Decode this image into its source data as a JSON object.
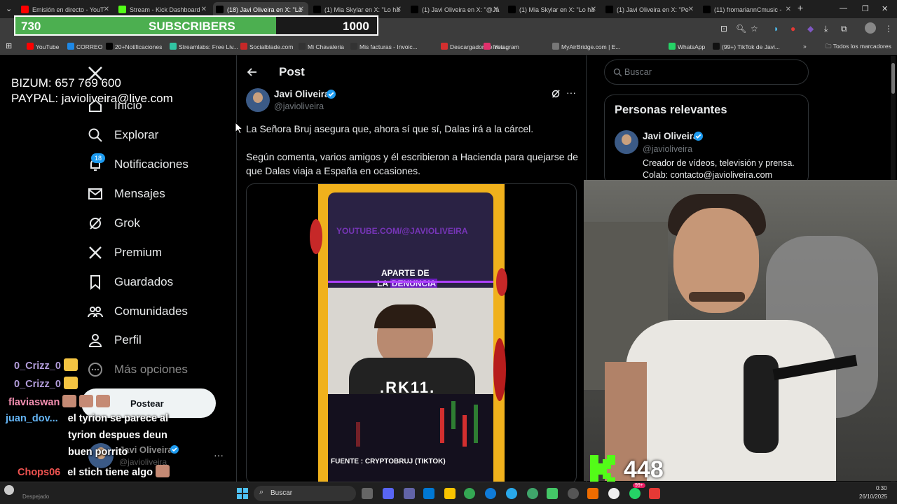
{
  "browser": {
    "tabs": [
      {
        "label": "Emisión en directo - YouT",
        "color": "#ff0000"
      },
      {
        "label": "Stream - Kick Dashboard",
        "color": "#53fc18"
      },
      {
        "label": "(18) Javi Oliveira en X: \"La",
        "color": "#000000"
      },
      {
        "label": "(1) Mia Skylar en X: \"Lo ha",
        "color": "#000000"
      },
      {
        "label": "(1) Javi Oliveira en X: \"@Ja",
        "color": "#000000"
      },
      {
        "label": "(1) Mia Skylar en X: \"Lo ha",
        "color": "#000000"
      },
      {
        "label": "(1) Javi Oliveira en X: \"Pe",
        "color": "#000000"
      },
      {
        "label": "(11) fromariannCmusic -",
        "color": "#000000"
      }
    ],
    "bookmarks": [
      {
        "label": "YouTube",
        "color": "#ff0000"
      },
      {
        "label": "CORREO",
        "color": "#1e88e5"
      },
      {
        "label": "20+Notificaciones",
        "color": "#000000"
      },
      {
        "label": "Streamlabs: Free Liv...",
        "color": "#31c3a2"
      },
      {
        "label": "Socialblade.com",
        "color": "#c62828"
      },
      {
        "label": "Mi Chavaleria",
        "color": "#333333"
      },
      {
        "label": "Mis facturas - Invoic...",
        "color": "#333333"
      },
      {
        "label": "Descargador de You...",
        "color": "#d32f2f"
      },
      {
        "label": "Instagram",
        "color": "#e1306c"
      },
      {
        "label": "MyAirBridge.com | E...",
        "color": "#777777"
      },
      {
        "label": "WhatsApp",
        "color": "#25d366"
      },
      {
        "label": "(99+) TikTok de Javi...",
        "color": "#111111"
      }
    ],
    "all_bookmarks": "Todos los marcadores"
  },
  "overlay": {
    "subs_current": "730",
    "subs_label": "SUBSCRIBERS",
    "subs_goal": "1000",
    "subs_progress": 0.73,
    "donation_line1": "BIZUM: 657 769 600",
    "donation_line2": "PAYPAL: javioliveira@live.com",
    "kick_count": "448"
  },
  "nav": {
    "home": "Inicio",
    "explore": "Explorar",
    "notifications": "Notificaciones",
    "notifications_badge": "18",
    "messages": "Mensajes",
    "grok": "Grok",
    "premium": "Premium",
    "bookmarks": "Guardados",
    "communities": "Comunidades",
    "profile": "Perfil",
    "more": "Más opciones",
    "post_button": "Postear",
    "account_name": "Javi Oliveira",
    "account_handle": "@javioliveira"
  },
  "post": {
    "header": "Post",
    "author_name": "Javi Oliveira",
    "author_handle": "@javioliveira",
    "text1": "La Señora Bruj asegura que, ahora sí que sí, Dalas irá a la cárcel.",
    "text2": "Según comenta, varios amigos y él escribieron a Hacienda para quejarse de que Dalas viaja a España en ocasiones.",
    "video_watermark": "YOUTUBE.COM/@JAVIOLIVEIRA",
    "video_caption1": "APARTE DE",
    "video_caption2a": "LA ",
    "video_caption2b": "DENUNCIA",
    "video_lower_text": ".RK11.",
    "video_source": "FUENTE : CRYPTOBRUJ (TIKTOK)"
  },
  "sidebar": {
    "search_placeholder": "Buscar",
    "relevant_title": "Personas relevantes",
    "person_name": "Javi Oliveira",
    "person_handle": "@javioliveira",
    "person_bio1": "Creador de vídeos, televisión y prensa.",
    "person_bio2": "Colab: contacto@javioliveira.com"
  },
  "chat": [
    {
      "user": "0_Crizz_0",
      "color": "#b39ddb",
      "msg": ""
    },
    {
      "user": "0_Crizz_0",
      "color": "#b39ddb",
      "msg": ""
    },
    {
      "user": "flaviaswan",
      "color": "#f48fb1",
      "msg": ""
    },
    {
      "user": "juan_dov...",
      "color": "#64b5f6",
      "msg": "el tyrion se parece al"
    },
    {
      "user": "",
      "color": "#ffffff",
      "msg": "tyrion despues deun"
    },
    {
      "user": "",
      "color": "#ffffff",
      "msg": "buen porrito"
    },
    {
      "user": "Chops06",
      "color": "#ef5350",
      "msg": "el stich tiene algo"
    },
    {
      "user": "flaviaswan",
      "color": "#f48fb1",
      "msg": ""
    }
  ],
  "taskbar": {
    "search": "Buscar",
    "weather": "Despejado",
    "time": "0:30",
    "date": "26/10/2025",
    "whatsapp_badge": "99+"
  }
}
